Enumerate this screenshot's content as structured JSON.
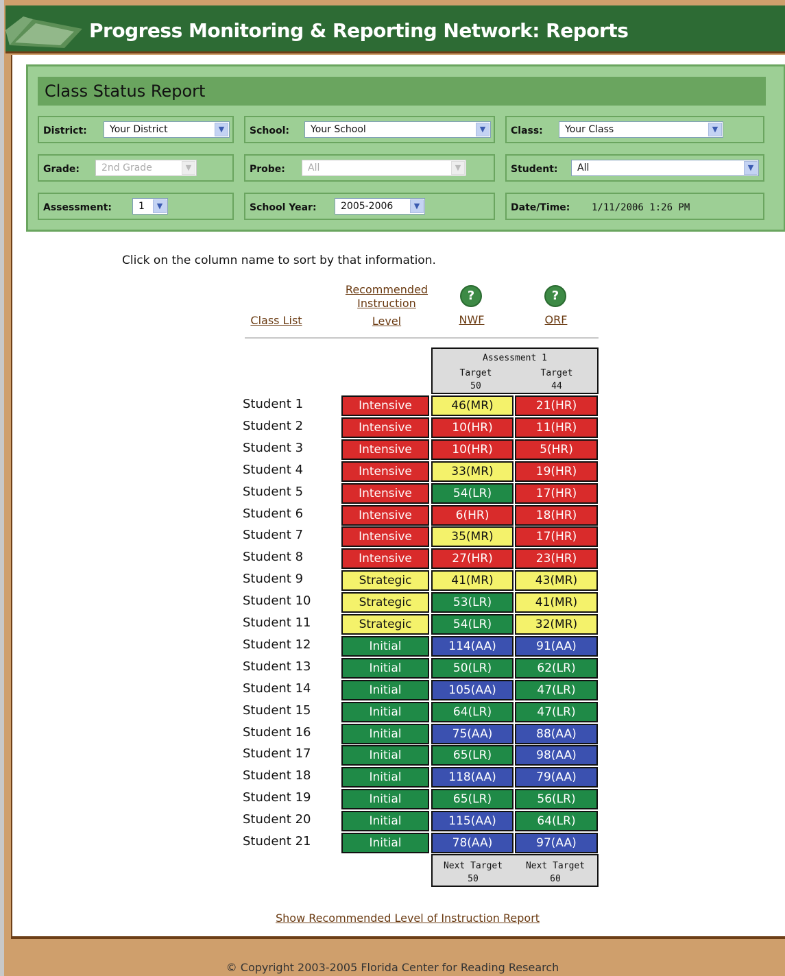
{
  "header": {
    "title": "Progress Monitoring & Reporting Network: Reports"
  },
  "report": {
    "title": "Class Status Report"
  },
  "filters": {
    "district": {
      "label": "District:",
      "value": "Your District"
    },
    "school": {
      "label": "School:",
      "value": "Your School"
    },
    "class": {
      "label": "Class:",
      "value": "Your Class"
    },
    "grade": {
      "label": "Grade:",
      "value": "2nd Grade"
    },
    "probe": {
      "label": "Probe:",
      "value": "All"
    },
    "student": {
      "label": "Student:",
      "value": "All"
    },
    "assessment": {
      "label": "Assessment:",
      "value": "1"
    },
    "school_year": {
      "label": "School Year:",
      "value": "2005-2006"
    },
    "datetime": {
      "label": "Date/Time:",
      "value": "1/11/2006 1:26 PM"
    }
  },
  "instructions": "Click on the column name to sort by that information.",
  "columns": {
    "class_list": "Class List",
    "rec_line1": "Recommended",
    "rec_line2": "Instruction",
    "rec_line3": "Level",
    "nwf": "NWF",
    "orf": "ORF",
    "help_glyph": "?"
  },
  "assessment_header": {
    "title": "Assessment 1",
    "nwf_target_label": "Target",
    "nwf_target_value": "50",
    "orf_target_label": "Target",
    "orf_target_value": "44"
  },
  "next_targets": {
    "nwf_label": "Next Target",
    "nwf_value": "50",
    "orf_label": "Next Target",
    "orf_value": "60"
  },
  "colors": {
    "red": "#d92b2b",
    "yellow": "#f4f26b",
    "green": "#1f8a47",
    "blue": "#3b51b0"
  },
  "students": [
    {
      "name": "Student 1",
      "level": "Intensive",
      "level_color": "red",
      "nwf": "46(MR)",
      "nwf_color": "yel",
      "orf": "21(HR)",
      "orf_color": "red"
    },
    {
      "name": "Student 2",
      "level": "Intensive",
      "level_color": "red",
      "nwf": "10(HR)",
      "nwf_color": "red",
      "orf": "11(HR)",
      "orf_color": "red"
    },
    {
      "name": "Student 3",
      "level": "Intensive",
      "level_color": "red",
      "nwf": "10(HR)",
      "nwf_color": "red",
      "orf": "5(HR)",
      "orf_color": "red"
    },
    {
      "name": "Student 4",
      "level": "Intensive",
      "level_color": "red",
      "nwf": "33(MR)",
      "nwf_color": "yel",
      "orf": "19(HR)",
      "orf_color": "red"
    },
    {
      "name": "Student 5",
      "level": "Intensive",
      "level_color": "red",
      "nwf": "54(LR)",
      "nwf_color": "grn",
      "orf": "17(HR)",
      "orf_color": "red"
    },
    {
      "name": "Student 6",
      "level": "Intensive",
      "level_color": "red",
      "nwf": "6(HR)",
      "nwf_color": "red",
      "orf": "18(HR)",
      "orf_color": "red"
    },
    {
      "name": "Student 7",
      "level": "Intensive",
      "level_color": "red",
      "nwf": "35(MR)",
      "nwf_color": "yel",
      "orf": "17(HR)",
      "orf_color": "red"
    },
    {
      "name": "Student 8",
      "level": "Intensive",
      "level_color": "red",
      "nwf": "27(HR)",
      "nwf_color": "red",
      "orf": "23(HR)",
      "orf_color": "red"
    },
    {
      "name": "Student 9",
      "level": "Strategic",
      "level_color": "yel",
      "nwf": "41(MR)",
      "nwf_color": "yel",
      "orf": "43(MR)",
      "orf_color": "yel"
    },
    {
      "name": "Student 10",
      "level": "Strategic",
      "level_color": "yel",
      "nwf": "53(LR)",
      "nwf_color": "grn",
      "orf": "41(MR)",
      "orf_color": "yel"
    },
    {
      "name": "Student 11",
      "level": "Strategic",
      "level_color": "yel",
      "nwf": "54(LR)",
      "nwf_color": "grn",
      "orf": "32(MR)",
      "orf_color": "yel"
    },
    {
      "name": "Student 12",
      "level": "Initial",
      "level_color": "grn",
      "nwf": "114(AA)",
      "nwf_color": "blu",
      "orf": "91(AA)",
      "orf_color": "blu"
    },
    {
      "name": "Student 13",
      "level": "Initial",
      "level_color": "grn",
      "nwf": "50(LR)",
      "nwf_color": "grn",
      "orf": "62(LR)",
      "orf_color": "grn"
    },
    {
      "name": "Student 14",
      "level": "Initial",
      "level_color": "grn",
      "nwf": "105(AA)",
      "nwf_color": "blu",
      "orf": "47(LR)",
      "orf_color": "grn"
    },
    {
      "name": "Student 15",
      "level": "Initial",
      "level_color": "grn",
      "nwf": "64(LR)",
      "nwf_color": "grn",
      "orf": "47(LR)",
      "orf_color": "grn"
    },
    {
      "name": "Student 16",
      "level": "Initial",
      "level_color": "grn",
      "nwf": "75(AA)",
      "nwf_color": "blu",
      "orf": "88(AA)",
      "orf_color": "blu"
    },
    {
      "name": "Student 17",
      "level": "Initial",
      "level_color": "grn",
      "nwf": "65(LR)",
      "nwf_color": "grn",
      "orf": "98(AA)",
      "orf_color": "blu"
    },
    {
      "name": "Student 18",
      "level": "Initial",
      "level_color": "grn",
      "nwf": "118(AA)",
      "nwf_color": "blu",
      "orf": "79(AA)",
      "orf_color": "blu"
    },
    {
      "name": "Student 19",
      "level": "Initial",
      "level_color": "grn",
      "nwf": "65(LR)",
      "nwf_color": "grn",
      "orf": "56(LR)",
      "orf_color": "grn"
    },
    {
      "name": "Student 20",
      "level": "Initial",
      "level_color": "grn",
      "nwf": "115(AA)",
      "nwf_color": "blu",
      "orf": "64(LR)",
      "orf_color": "grn"
    },
    {
      "name": "Student 21",
      "level": "Initial",
      "level_color": "grn",
      "nwf": "78(AA)",
      "nwf_color": "blu",
      "orf": "97(AA)",
      "orf_color": "blu"
    }
  ],
  "show_report_link": "Show Recommended Level of Instruction Report",
  "footer": "© Copyright 2003-2005 Florida Center for Reading Research"
}
